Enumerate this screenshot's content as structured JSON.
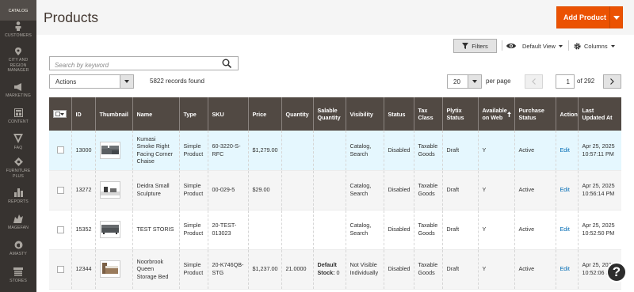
{
  "sidebar": {
    "items": [
      {
        "label": "CATALOG",
        "icon": "catalog-icon"
      },
      {
        "label": "CUSTOMERS",
        "icon": "customers-icon"
      },
      {
        "label": "CITY AND REGION MANAGER",
        "icon": "location-icon"
      },
      {
        "label": "MARKETING",
        "icon": "megaphone-icon"
      },
      {
        "label": "CONTENT",
        "icon": "content-icon"
      },
      {
        "label": "FAQ",
        "icon": "faq-icon"
      },
      {
        "label": "FURNITURE PLUS",
        "icon": "furniture-icon"
      },
      {
        "label": "REPORTS",
        "icon": "reports-icon"
      },
      {
        "label": "MAGEFAN",
        "icon": "magefan-icon"
      },
      {
        "label": "AMASTY",
        "icon": "amasty-icon"
      },
      {
        "label": "STORES",
        "icon": "stores-icon"
      }
    ]
  },
  "header": {
    "title": "Products",
    "add_button": "Add Product"
  },
  "toolbar": {
    "filters_label": "Filters",
    "view_label": "Default View",
    "columns_label": "Columns",
    "search_placeholder": "Search by keyword",
    "actions_label": "Actions",
    "records_found": "5822 records found",
    "per_page": "20",
    "per_page_label": "per page",
    "current_page": "1",
    "total_pages": "of 292"
  },
  "table": {
    "headers": [
      "",
      "ID",
      "Thumbnail",
      "Name",
      "Type",
      "SKU",
      "Price",
      "Quantity",
      "Salable Quantity",
      "Visibility",
      "Status",
      "Tax Class",
      "Plytix Status",
      "Available on Web",
      "Purchase Status",
      "Action",
      "Last Updated At"
    ],
    "rows": [
      {
        "id": "13000",
        "name": "Kumasi Smoke Right Facing Corner Chaise",
        "type": "Simple Product",
        "sku": "60-3220-S-RFC",
        "price": "$1,279.00",
        "quantity": "",
        "salable_bold": "",
        "salable_rest": "",
        "visibility": "Catalog, Search",
        "status": "Disabled",
        "tax_class": "Taxable Goods",
        "plytix_status": "Draft",
        "available_on_web": "Y",
        "purchase_status": "Active",
        "action": "Edit",
        "updated": "Apr 25, 2025 10:57:11 PM"
      },
      {
        "id": "13272",
        "name": "Deidra Small Sculpture",
        "type": "Simple Product",
        "sku": "00-029-5",
        "price": "$29.00",
        "quantity": "",
        "salable_bold": "",
        "salable_rest": "",
        "visibility": "Catalog, Search",
        "status": "Disabled",
        "tax_class": "Taxable Goods",
        "plytix_status": "Draft",
        "available_on_web": "Y",
        "purchase_status": "Active",
        "action": "Edit",
        "updated": "Apr 25, 2025 10:56:14 PM"
      },
      {
        "id": "15352",
        "name": "TEST STORIS",
        "type": "Simple Product",
        "sku": "20-TEST-013023",
        "price": "",
        "quantity": "",
        "salable_bold": "",
        "salable_rest": "",
        "visibility": "Catalog, Search",
        "status": "Disabled",
        "tax_class": "Taxable Goods",
        "plytix_status": "Draft",
        "available_on_web": "Y",
        "purchase_status": "Active",
        "action": "Edit",
        "updated": "Apr 25, 2025 10:52:50 PM"
      },
      {
        "id": "12344",
        "name": "Noorbrook Queen Storage Bed",
        "type": "Simple Product",
        "sku": "20-K746QB-STG",
        "price": "$1,237.00",
        "quantity": "21.0000",
        "salable_bold": "Default Stock:",
        "salable_rest": " 0",
        "visibility": "Not Visible Individually",
        "status": "Disabled",
        "tax_class": "Taxable Goods",
        "plytix_status": "Draft",
        "available_on_web": "Y",
        "purchase_status": "Active",
        "action": "Edit",
        "updated": "Apr 25, 2025 10:52:06 PM"
      }
    ]
  },
  "help_label": "?",
  "colors": {
    "accent": "#eb5202",
    "sidebar": "#373330",
    "table_header": "#514943",
    "link": "#006bb4"
  }
}
